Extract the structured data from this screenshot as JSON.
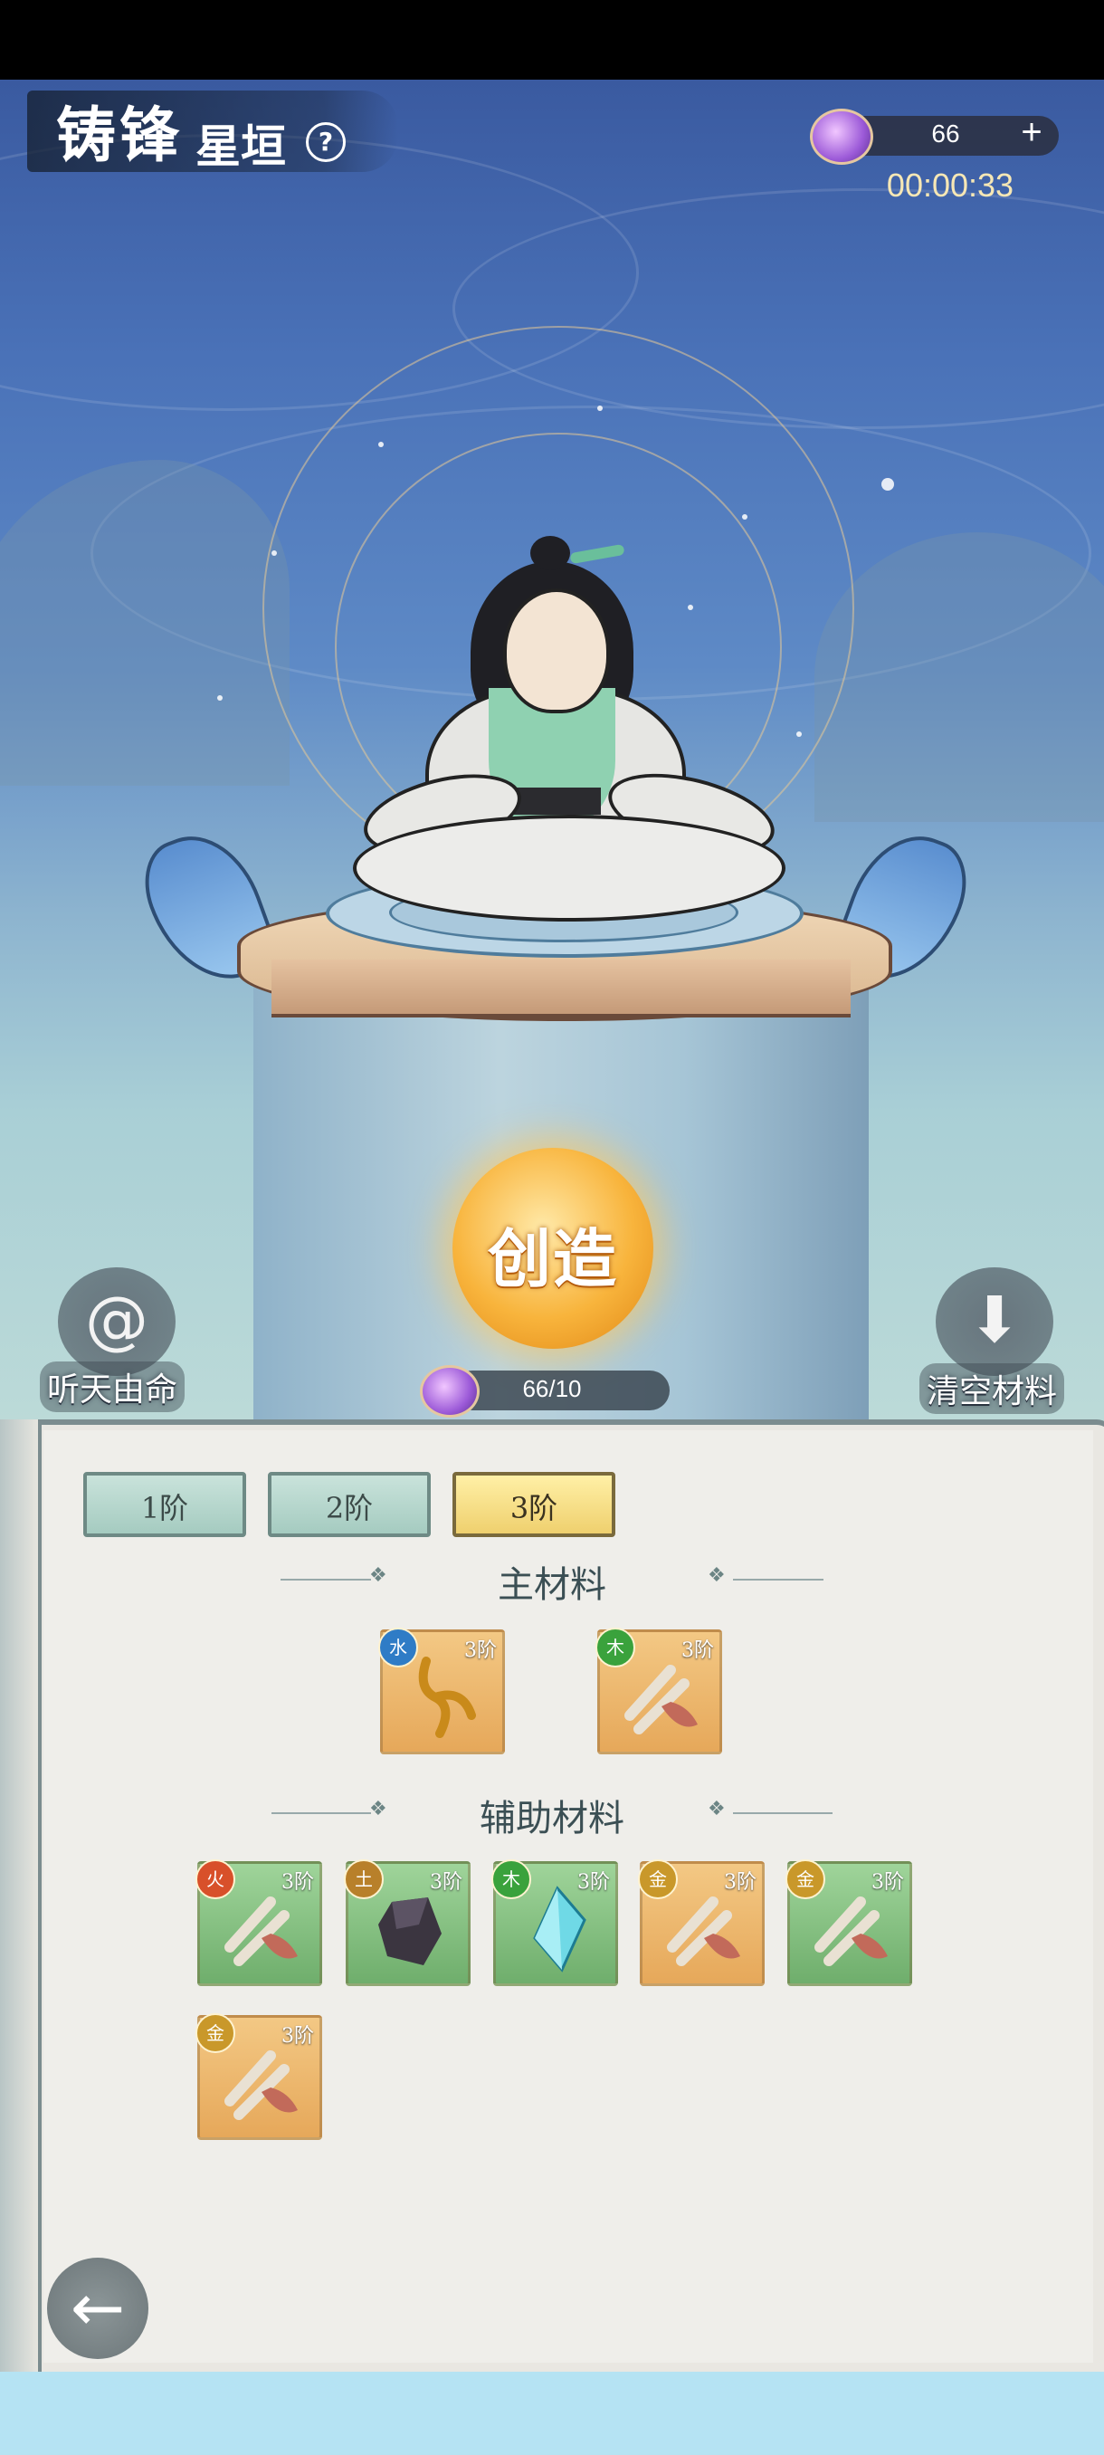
{
  "header": {
    "title_main": "铸锋",
    "title_sub": "星垣",
    "help_icon": "question-icon"
  },
  "currency": {
    "icon": "crystal-orb-icon",
    "value": "66",
    "plus_label": "+"
  },
  "timer": "00:00:33",
  "create_button": {
    "label": "创造"
  },
  "cost": {
    "icon": "crystal-orb-icon",
    "value": "66/10"
  },
  "left_action": {
    "label": "听天由命",
    "icon": "swirl-icon"
  },
  "right_action": {
    "label": "清空材料",
    "icon": "download-icon"
  },
  "tiers": [
    {
      "label": "1阶",
      "active": false
    },
    {
      "label": "2阶",
      "active": false
    },
    {
      "label": "3阶",
      "active": true
    }
  ],
  "main_materials": {
    "title": "主材料",
    "items": [
      {
        "element": "水",
        "tier": "3阶",
        "color": "orange",
        "art": "golden-root"
      },
      {
        "element": "木",
        "tier": "3阶",
        "color": "orange",
        "art": "bone-claw"
      }
    ]
  },
  "aux_materials": {
    "title": "辅助材料",
    "items": [
      {
        "element": "火",
        "tier": "3阶",
        "color": "green",
        "art": "bone-claw"
      },
      {
        "element": "土",
        "tier": "3阶",
        "color": "green",
        "art": "dark-ore"
      },
      {
        "element": "木",
        "tier": "3阶",
        "color": "green",
        "art": "ice-crystal"
      },
      {
        "element": "金",
        "tier": "3阶",
        "color": "orange",
        "art": "bone-claw"
      },
      {
        "element": "金",
        "tier": "3阶",
        "color": "green",
        "art": "bone-claw"
      },
      {
        "element": "金",
        "tier": "3阶",
        "color": "orange",
        "art": "bone-claw"
      }
    ]
  },
  "back_button": {
    "icon": "back-arrow-icon"
  }
}
